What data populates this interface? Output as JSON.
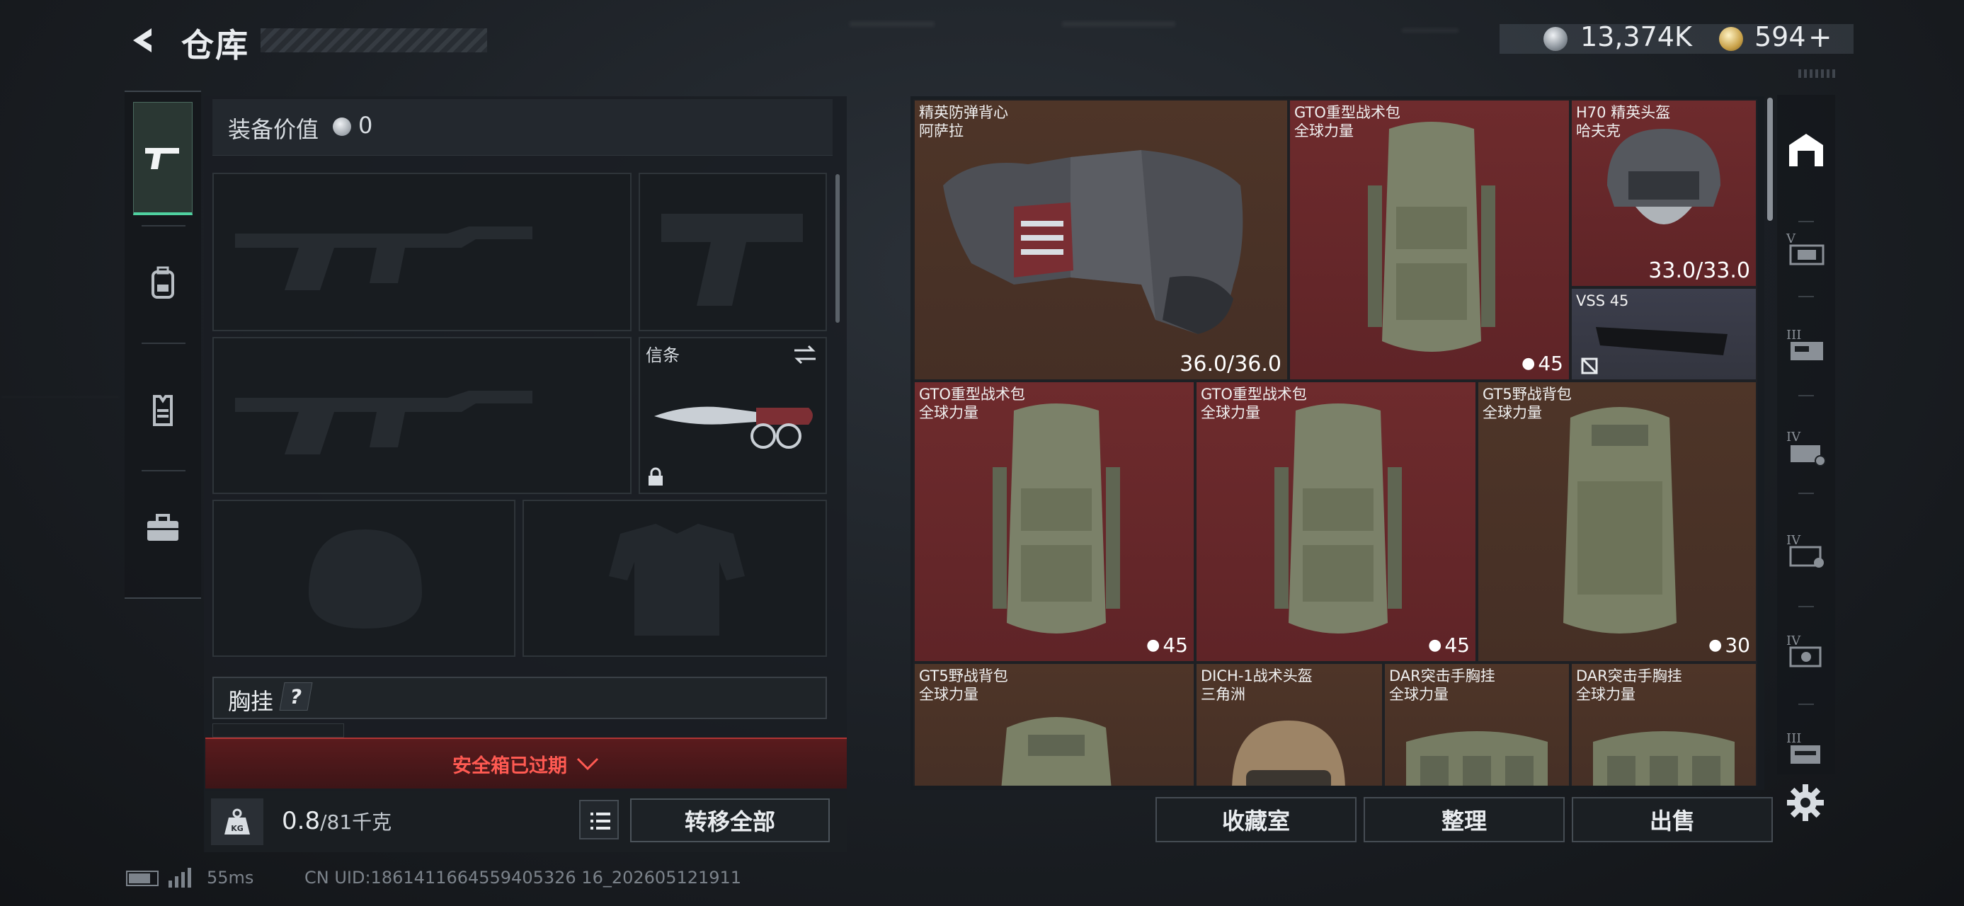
{
  "header": {
    "title": "仓库",
    "currency1": "13,374K",
    "currency2": "594",
    "add_symbol": "+"
  },
  "colors": {
    "accent_green": "#4fd1a0",
    "alert_red": "#ff5a52",
    "item_red": "#6e2b2d",
    "item_brown": "#4e3528",
    "item_blue": "#3c3e4c"
  },
  "left_nav": {
    "items": [
      {
        "icon": "pistol-icon",
        "active": true
      },
      {
        "icon": "backpack-icon",
        "active": false
      },
      {
        "icon": "vest-icon",
        "active": false
      },
      {
        "icon": "toolbox-icon",
        "active": false
      }
    ]
  },
  "equipment": {
    "value_label": "装备价值",
    "value": "0",
    "melee_label": "信条",
    "slots": [
      "primary-weapon-icon",
      "pistol-icon",
      "secondary-weapon-icon",
      "knife-icon",
      "helmet-icon",
      "armor-icon"
    ],
    "chest_label": "胸挂",
    "chest_help": "?",
    "alert": "安全箱已过期",
    "weight_current": "0.8",
    "weight_rest": "/81千克",
    "transfer_all": "转移全部"
  },
  "inventory": {
    "items": [
      {
        "name": "精英防弹背心",
        "sub": "阿萨拉",
        "rarity": "brown",
        "durability": "36.0/36.0",
        "icon": "armor-vest-icon"
      },
      {
        "name": "GTO重型战术包",
        "sub": "全球力量",
        "rarity": "red",
        "capacity": "45",
        "icon": "backpack-icon"
      },
      {
        "name": "H70 精英头盔",
        "sub": "哈夫克",
        "rarity": "red",
        "durability": "33.0/33.0",
        "icon": "helmet-icon"
      },
      {
        "name": "VSS 45",
        "sub": "",
        "rarity": "blue",
        "icon": "magazine-icon"
      },
      {
        "name": "GTO重型战术包",
        "sub": "全球力量",
        "rarity": "red",
        "capacity": "45",
        "icon": "backpack-icon"
      },
      {
        "name": "GTO重型战术包",
        "sub": "全球力量",
        "rarity": "red",
        "capacity": "45",
        "icon": "backpack-icon"
      },
      {
        "name": "GT5野战背包",
        "sub": "全球力量",
        "rarity": "brown",
        "capacity": "30",
        "icon": "backpack-icon"
      },
      {
        "name": "GT5野战背包",
        "sub": "全球力量",
        "rarity": "brown",
        "icon": "backpack-icon"
      },
      {
        "name": "DICH-1战术头盔",
        "sub": "三角洲",
        "rarity": "brown",
        "icon": "helmet-icon"
      },
      {
        "name": "DAR突击手胸挂",
        "sub": "全球力量",
        "rarity": "brown",
        "icon": "chest-rig-icon"
      },
      {
        "name": "DAR突击手胸挂",
        "sub": "全球力量",
        "rarity": "brown",
        "icon": "chest-rig-icon"
      }
    ],
    "actions": [
      "收藏室",
      "整理",
      "出售"
    ]
  },
  "right_nav": {
    "items": [
      {
        "icon": "storage-icon",
        "tier": ""
      },
      {
        "icon": "weapon-case-icon",
        "tier": "V"
      },
      {
        "icon": "medical-case-icon",
        "tier": "III"
      },
      {
        "icon": "key-case-icon",
        "tier": "IV"
      },
      {
        "icon": "ammo-case-icon",
        "tier": "IV"
      },
      {
        "icon": "parts-case-icon",
        "tier": "IV"
      },
      {
        "icon": "tool-case-icon",
        "tier": "III"
      }
    ],
    "settings_icon": "gear-icon"
  },
  "status": {
    "ping": "55ms",
    "uid": "CN UID:1861411664559405326 16_202605121911"
  }
}
